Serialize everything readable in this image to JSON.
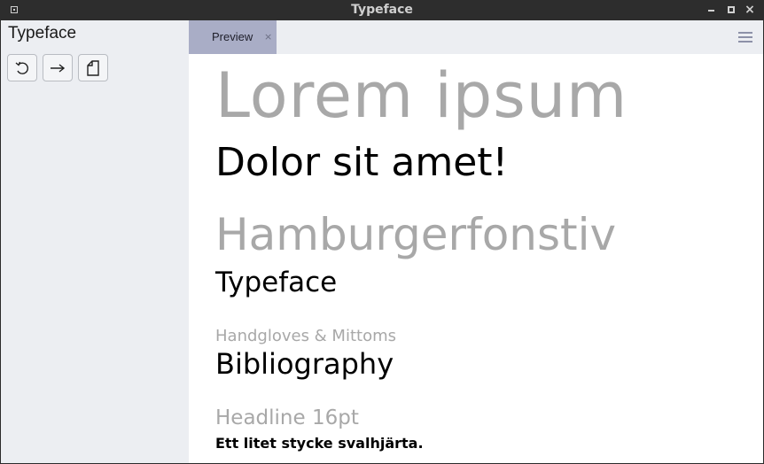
{
  "window": {
    "title": "Typeface",
    "controls": [
      "minimize-icon",
      "maximize-icon",
      "close-icon"
    ],
    "close_glyph": "×"
  },
  "sidebar": {
    "app_name": "Typeface",
    "toolbar_icons": [
      "reload-icon",
      "arrow-right-icon",
      "document-icon"
    ]
  },
  "tabs": [
    {
      "label": "Preview",
      "close_glyph": "×",
      "active": true
    }
  ],
  "menu": {
    "icon": "hamburger-menu-icon"
  },
  "preview": {
    "lines": [
      "Lorem ipsum",
      "Dolor sit amet!",
      "Hamburgerfonstiv",
      "Typeface",
      "Handgloves & Mittoms",
      "Bibliography",
      "Headline 16pt",
      "Ett litet stycke svalhjärta."
    ]
  },
  "colors": {
    "titlebar": "#2d2d2d",
    "sidebar": "#eceef2",
    "active_tab": "#a9adc6",
    "muted_text": "#a8a8a8",
    "text": "#000000"
  }
}
